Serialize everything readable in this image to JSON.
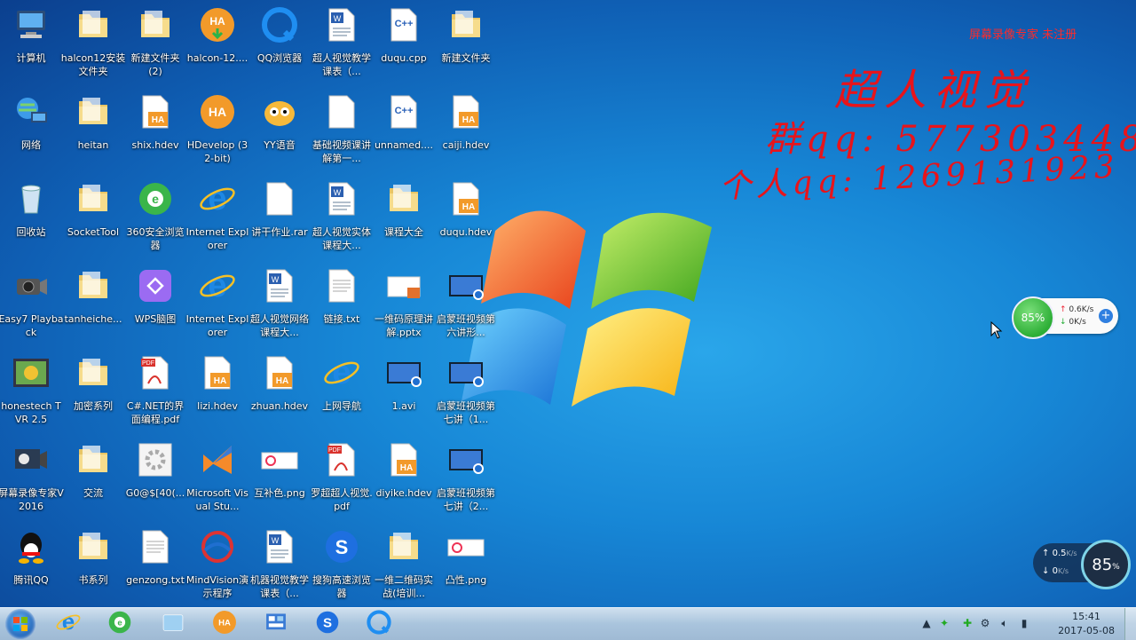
{
  "watermark": "屏幕录像专家 未注册",
  "handwriting": {
    "title": "超人视觉",
    "line1": "群qq: 577303448",
    "line2": "个人qq: 1269131923"
  },
  "icons": [
    {
      "label": "计算机",
      "icon": "computer-icon"
    },
    {
      "label": "halcon12安装文件夹",
      "icon": "folder-icon"
    },
    {
      "label": "新建文件夹 (2)",
      "icon": "folder-icon"
    },
    {
      "label": "halcon-12....",
      "icon": "halcon-installer-icon"
    },
    {
      "label": "QQ浏览器",
      "icon": "qq-browser-icon"
    },
    {
      "label": "超人视觉教学课表（...",
      "icon": "word-doc-icon"
    },
    {
      "label": "duqu.cpp",
      "icon": "cpp-file-icon"
    },
    {
      "label": "新建文件夹",
      "icon": "folder-icon"
    },
    {
      "label": "网络",
      "icon": "network-icon"
    },
    {
      "label": "heitan",
      "icon": "folder-icon"
    },
    {
      "label": "shix.hdev",
      "icon": "hdev-file-icon"
    },
    {
      "label": "HDevelop (32-bit)",
      "icon": "hdevelop-icon"
    },
    {
      "label": "YY语音",
      "icon": "yy-voice-icon"
    },
    {
      "label": "基础视频课讲解第一...",
      "icon": "blank-file-icon"
    },
    {
      "label": "unnamed....",
      "icon": "cpp-file-icon"
    },
    {
      "label": "caiji.hdev",
      "icon": "hdev-file-icon"
    },
    {
      "label": "回收站",
      "icon": "recycle-bin-icon"
    },
    {
      "label": "SocketTool",
      "icon": "folder-icon"
    },
    {
      "label": "360安全浏览器",
      "icon": "360-browser-icon"
    },
    {
      "label": "Internet Explorer",
      "icon": "ie-icon"
    },
    {
      "label": "讲干作业.rar",
      "icon": "blank-file-icon"
    },
    {
      "label": "超人视觉实体课程大...",
      "icon": "word-doc-icon"
    },
    {
      "label": "课程大全",
      "icon": "folder-icon"
    },
    {
      "label": "duqu.hdev",
      "icon": "hdev-file-icon"
    },
    {
      "label": "Easy7 Playback",
      "icon": "camera-icon"
    },
    {
      "label": "tanheiche...",
      "icon": "folder-icon"
    },
    {
      "label": "WPS脑图",
      "icon": "wps-mindmap-icon"
    },
    {
      "label": "Internet Explorer",
      "icon": "ie-icon"
    },
    {
      "label": "超人视觉网络课程大...",
      "icon": "word-doc-icon"
    },
    {
      "label": "链接.txt",
      "icon": "text-file-icon"
    },
    {
      "label": "一维码原理讲解.pptx",
      "icon": "pptx-file-icon"
    },
    {
      "label": "启蒙班视频第六讲形...",
      "icon": "video-file-icon"
    },
    {
      "label": "honestech TVR 2.5",
      "icon": "tvr-icon"
    },
    {
      "label": "加密系列",
      "icon": "folder-icon"
    },
    {
      "label": "C#.NET的界面编程.pdf",
      "icon": "pdf-file-icon"
    },
    {
      "label": "lizi.hdev",
      "icon": "hdev-file-icon"
    },
    {
      "label": "zhuan.hdev",
      "icon": "hdev-file-icon"
    },
    {
      "label": "上网导航",
      "icon": "ie-nav-icon"
    },
    {
      "label": "1.avi",
      "icon": "video-file-icon"
    },
    {
      "label": "启蒙班视频第七讲（1...",
      "icon": "video-file-icon"
    },
    {
      "label": "屏幕录像专家V2016",
      "icon": "screen-recorder-icon"
    },
    {
      "label": "交流",
      "icon": "folder-icon"
    },
    {
      "label": "G0@$[40(...",
      "icon": "gear-file-icon"
    },
    {
      "label": "Microsoft Visual Stu...",
      "icon": "visual-studio-icon"
    },
    {
      "label": "互补色.png",
      "icon": "png-file-icon"
    },
    {
      "label": "罗超超人视觉.pdf",
      "icon": "pdf-file-icon"
    },
    {
      "label": "diyike.hdev",
      "icon": "hdev-file-icon"
    },
    {
      "label": "启蒙班视频第七讲（2...",
      "icon": "video-file-icon"
    },
    {
      "label": "腾讯QQ",
      "icon": "qq-icon"
    },
    {
      "label": "书系列",
      "icon": "folder-icon"
    },
    {
      "label": "genzong.txt",
      "icon": "text-file-icon"
    },
    {
      "label": "MindVision演示程序",
      "icon": "mindvision-icon"
    },
    {
      "label": "机器视觉教学课表（...",
      "icon": "word-doc-icon"
    },
    {
      "label": "搜狗高速浏览器",
      "icon": "sogou-browser-icon"
    },
    {
      "label": "一维二维码实战(培训...",
      "icon": "folder-icon"
    },
    {
      "label": "凸性.png",
      "icon": "png-file-icon"
    }
  ],
  "net_widget": {
    "percent": "85%",
    "up": "0.6K/s",
    "down": "0K/s"
  },
  "net_widget2": {
    "up": "0.5",
    "up_unit": "K/s",
    "down": "0",
    "down_unit": "K/s",
    "percent": "85",
    "percent_unit": "%"
  },
  "taskbar": {
    "pinned": [
      "ie-icon",
      "360-browser-icon",
      "file-explorer-icon",
      "hdevelop-icon",
      "control-panel-icon",
      "sogou-browser-icon",
      "qq-browser-icon"
    ]
  },
  "clock": {
    "time": "15:41",
    "date": "2017-05-08"
  },
  "colors": {
    "handwriting": "#e8141b",
    "watermark": "#ff2a2a"
  }
}
